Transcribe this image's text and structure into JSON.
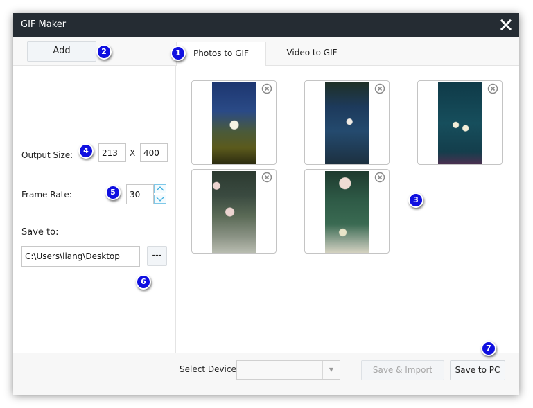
{
  "window": {
    "title": "GIF Maker",
    "close_icon": "close-icon"
  },
  "toolbar": {
    "add_label": "Add"
  },
  "tabs": [
    {
      "label": "Photos to GIF",
      "active": true
    },
    {
      "label": "Video to GIF",
      "active": false
    }
  ],
  "settings": {
    "output_size_label": "Output Size:",
    "width": "213",
    "separator": "X",
    "height": "400",
    "frame_rate_label": "Frame Rate:",
    "frame_rate": "30",
    "save_to_label": "Save to:",
    "save_path": "C:\\Users\\liang\\Desktop",
    "browse_label": "---"
  },
  "thumbnails": [
    {
      "name": "photo-1",
      "description": "white plum blossom with snow, blue and olive background"
    },
    {
      "name": "photo-2",
      "description": "small plum blossom on branch, dark blue background"
    },
    {
      "name": "photo-3",
      "description": "plum blossoms on branch, teal background with snow"
    },
    {
      "name": "photo-4",
      "description": "pink plum blossoms, green-grey background"
    },
    {
      "name": "photo-5",
      "description": "pink plum blossoms, green background"
    }
  ],
  "footer": {
    "select_device_label": "Select Device:",
    "select_device_value": "",
    "save_import_label": "Save & Import",
    "save_pc_label": "Save to PC"
  },
  "callouts": [
    "1",
    "2",
    "3",
    "4",
    "5",
    "6",
    "7"
  ],
  "colors": {
    "titlebar": "#252c33",
    "callout": "#1010e0",
    "spin_accent": "#7fc8e8"
  }
}
